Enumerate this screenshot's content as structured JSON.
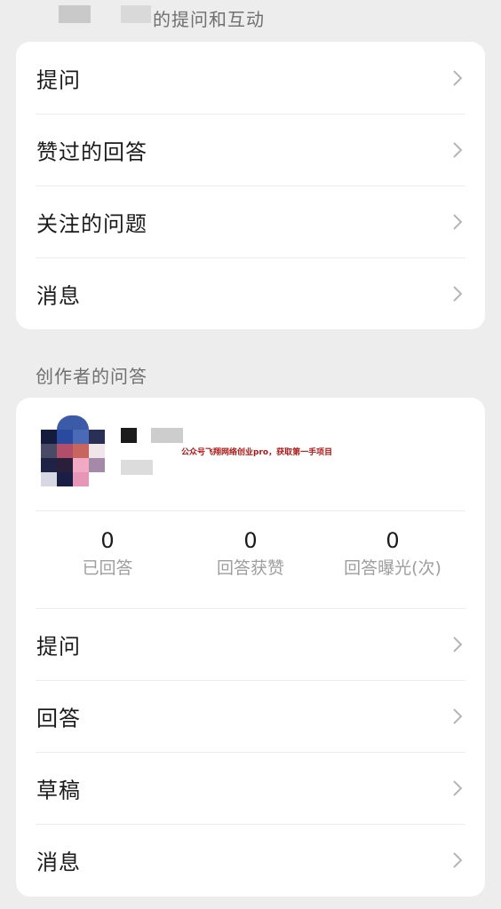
{
  "top_section": {
    "header": "的提问和互动",
    "items": [
      {
        "label": "提问"
      },
      {
        "label": "赞过的回答"
      },
      {
        "label": "关注的问题"
      },
      {
        "label": "消息"
      }
    ]
  },
  "creator_section": {
    "header": "创作者的问答",
    "watermark": "公众号飞翔网络创业pro，获取第一手项目",
    "stats": [
      {
        "value": "0",
        "label": "已回答"
      },
      {
        "value": "0",
        "label": "回答获赞"
      },
      {
        "value": "0",
        "label": "回答曝光(次)"
      }
    ],
    "items": [
      {
        "label": "提问"
      },
      {
        "label": "回答"
      },
      {
        "label": "草稿"
      },
      {
        "label": "消息"
      }
    ]
  },
  "icons": {
    "row_chevron": "chevron-right-icon"
  },
  "colors": {
    "background": "#ededed",
    "card": "#ffffff",
    "chevron": "#b5b5b5",
    "watermark": "#b01717"
  }
}
